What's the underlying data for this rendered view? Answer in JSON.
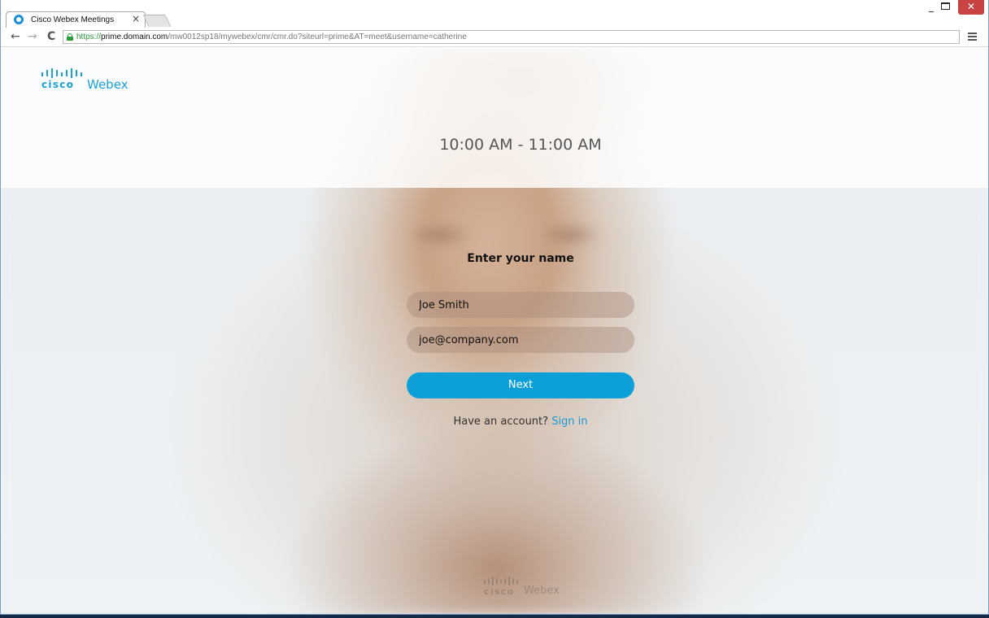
{
  "browser": {
    "tab_title": "Cisco Webex Meetings",
    "tab_close": "×",
    "url_scheme": "https://",
    "url_host": "prime.domain.com",
    "url_path": "/mw0012sp18/mywebex/cmr/cmr.do?siteurl=prime&AT=meet&username=catherine",
    "window_controls": {
      "minimize": "_",
      "close": "✕"
    },
    "nav": {
      "back": "←",
      "forward": "→",
      "reload": "C"
    }
  },
  "header": {
    "logo_cisco": "cisco",
    "logo_webex": "Webex",
    "meeting_time": "10:00 AM - 11:00 AM"
  },
  "form": {
    "title": "Enter your name",
    "name_value": "Joe Smith",
    "email_value": "joe@company.com",
    "next_label": "Next",
    "account_prompt": "Have an account?",
    "signin_label": "Sign in"
  },
  "footer": {
    "logo_cisco": "cisco",
    "logo_webex": "Webex"
  },
  "colors": {
    "accent": "#0d9fd8",
    "link": "#1b9ad6",
    "brand": "#1ba0d7"
  }
}
